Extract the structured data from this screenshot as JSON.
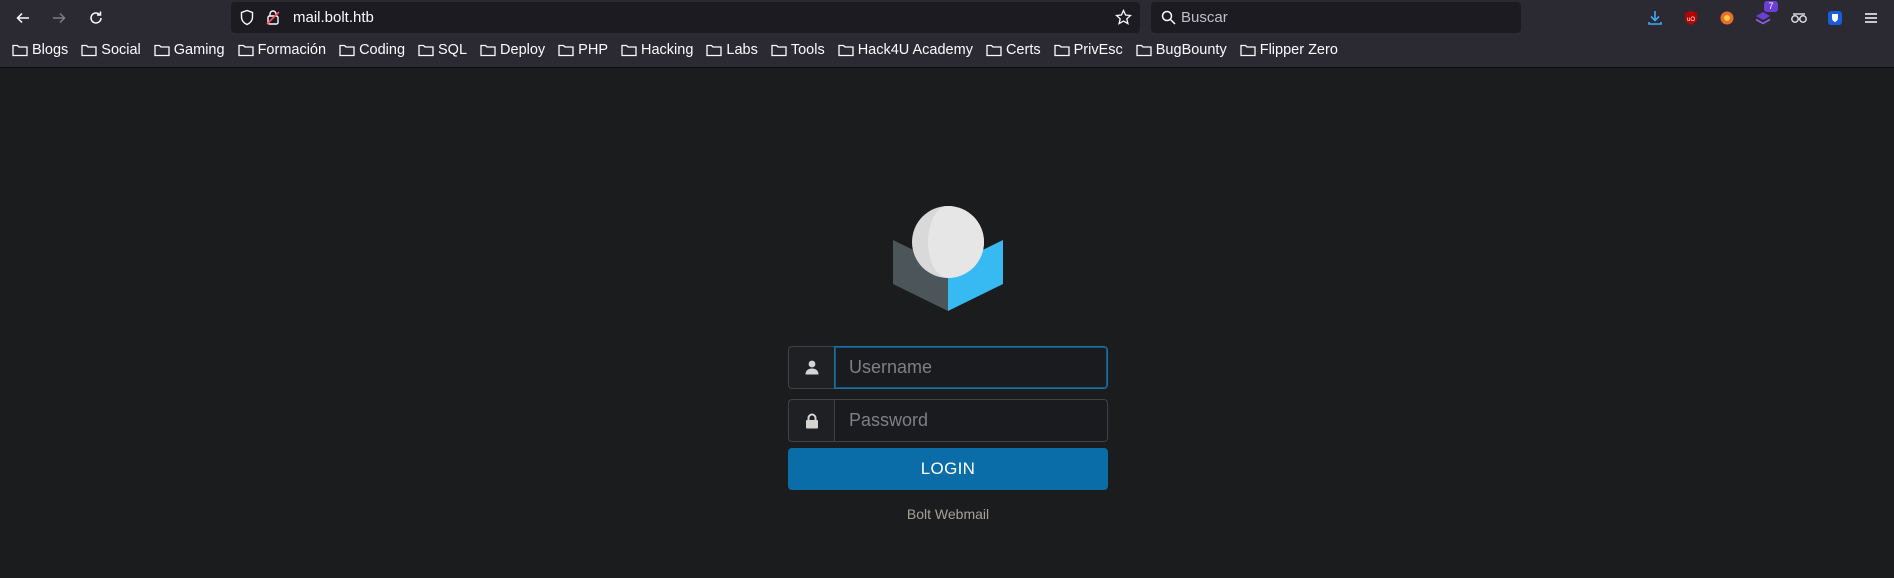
{
  "browser": {
    "url": "mail.bolt.htb",
    "search_placeholder": "Buscar",
    "extension_badge": "7",
    "bookmarks": [
      "Blogs",
      "Social",
      "Gaming",
      "Formación",
      "Coding",
      "SQL",
      "Deploy",
      "PHP",
      "Hacking",
      "Labs",
      "Tools",
      "Hack4U Academy",
      "Certs",
      "PrivEsc",
      "BugBounty",
      "Flipper Zero"
    ]
  },
  "login": {
    "username_placeholder": "Username",
    "password_placeholder": "Password",
    "button_label": "LOGIN",
    "footer": "Bolt Webmail"
  },
  "colors": {
    "background": "#1b1c1e",
    "toolbar": "#2b2a33",
    "button": "#0a6da7",
    "logo_accent": "#37b9f1"
  }
}
